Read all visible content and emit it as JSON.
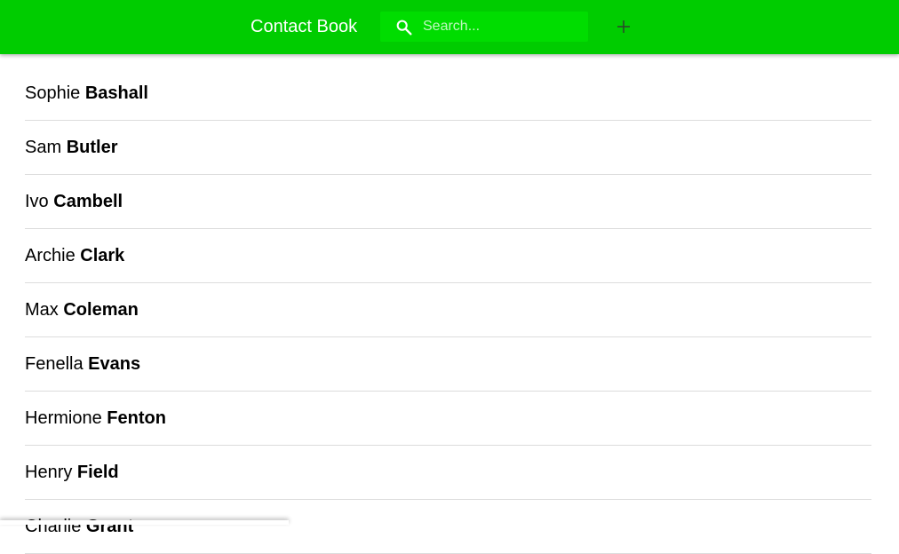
{
  "colors": {
    "app_bar": "#00cc00",
    "search_box": "#00dd00",
    "add_icon": "#2a4a2a"
  },
  "header": {
    "title": "Contact Book",
    "search": {
      "placeholder": "Search...",
      "value": "",
      "icon": "search-icon"
    },
    "add_button": {
      "icon": "plus-icon"
    }
  },
  "contacts": [
    {
      "first": "Sophie",
      "last": "Bashall"
    },
    {
      "first": "Sam",
      "last": "Butler"
    },
    {
      "first": "Ivo",
      "last": "Cambell"
    },
    {
      "first": "Archie",
      "last": "Clark"
    },
    {
      "first": "Max",
      "last": "Coleman"
    },
    {
      "first": "Fenella",
      "last": "Evans"
    },
    {
      "first": "Hermione",
      "last": "Fenton"
    },
    {
      "first": "Henry",
      "last": "Field"
    },
    {
      "first": "Charlie",
      "last": "Grant"
    }
  ]
}
